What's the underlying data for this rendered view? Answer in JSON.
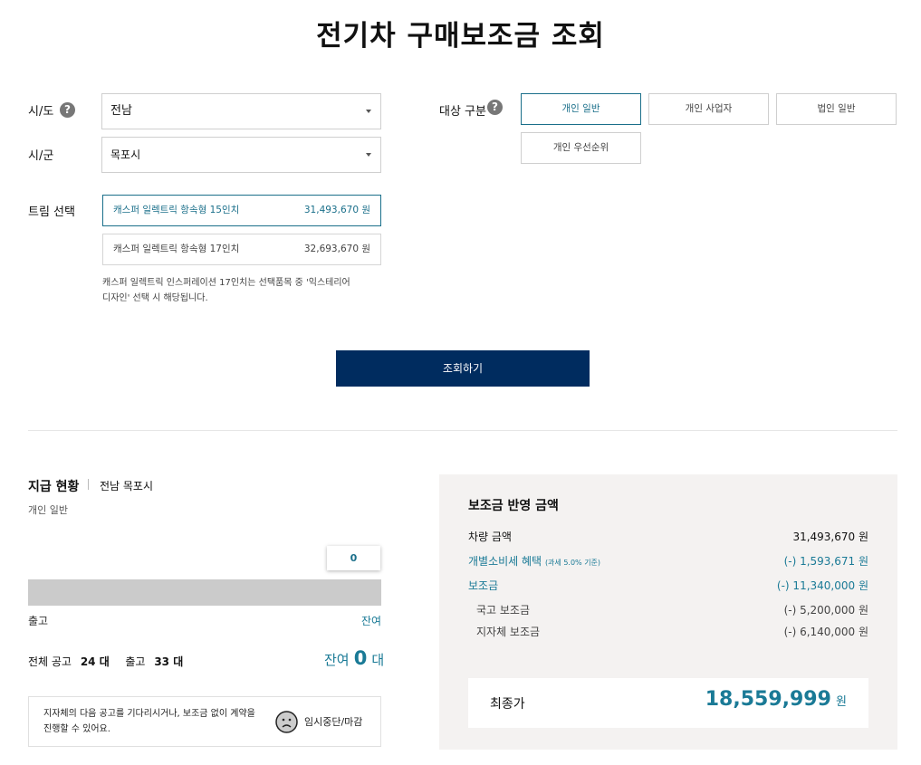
{
  "page_title": "전기차 구매보조금 조회",
  "form": {
    "sido": {
      "label": "시/도",
      "value": "전남"
    },
    "sigun": {
      "label": "시/군",
      "value": "목포시"
    },
    "trim": {
      "label": "트림 선택",
      "options": [
        {
          "name": "캐스퍼 일렉트릭 항속형 15인치",
          "price": "31,493,670 원",
          "selected": true
        },
        {
          "name": "캐스퍼 일렉트릭 항속형 17인치",
          "price": "32,693,670 원",
          "selected": false
        }
      ],
      "note_line1": "캐스퍼 일렉트릭 인스퍼레이션 17인치는 선택품목 중 '익스테리어",
      "note_line2": "디자인' 선택 시 해당됩니다."
    },
    "target": {
      "label": "대상 구분",
      "options": [
        {
          "label": "개인 일반",
          "selected": true
        },
        {
          "label": "개인 사업자",
          "selected": false
        },
        {
          "label": "법인 일반",
          "selected": false
        },
        {
          "label": "개인 우선순위",
          "selected": false
        }
      ]
    },
    "help_icon_glyph": "?",
    "search_button": "조회하기"
  },
  "status": {
    "title": "지급 현황",
    "region": "전남 목포시",
    "category": "개인 일반",
    "bubble_value": "0",
    "bar_left": "출고",
    "bar_right": "잔여",
    "total_label": "전체 공고",
    "total_value": "24 대",
    "released_label": "출고",
    "released_value": "33 대",
    "remaining_label": "잔여",
    "remaining_value": "0",
    "remaining_unit": "대",
    "notice_line1": "지자체의 다음 공고를 기다리시거나, 보조금 없이 계약을",
    "notice_line2": "진행할 수 있어요.",
    "suspend_label": "임시중단/마감"
  },
  "summary": {
    "title": "보조금 반영 금액",
    "vehicle_label": "차량 금액",
    "vehicle_value": "31,493,670 원",
    "tax_label": "개별소비세 혜택",
    "tax_note": "(과세 5.0% 기준)",
    "tax_value": "(-) 1,593,671 원",
    "subsidy_label": "보조금",
    "subsidy_value": "(-) 11,340,000 원",
    "national_label": "국고 보조금",
    "national_value": "(-) 5,200,000 원",
    "local_label": "지자체 보조금",
    "local_value": "(-) 6,140,000 원",
    "final_label": "최종가",
    "final_value": "18,559,999",
    "final_unit": "원"
  },
  "colors": {
    "primary": "#002c5f",
    "accent": "#1a7a96",
    "panel": "#f4f2f1",
    "bar": "#cbcbcb"
  }
}
